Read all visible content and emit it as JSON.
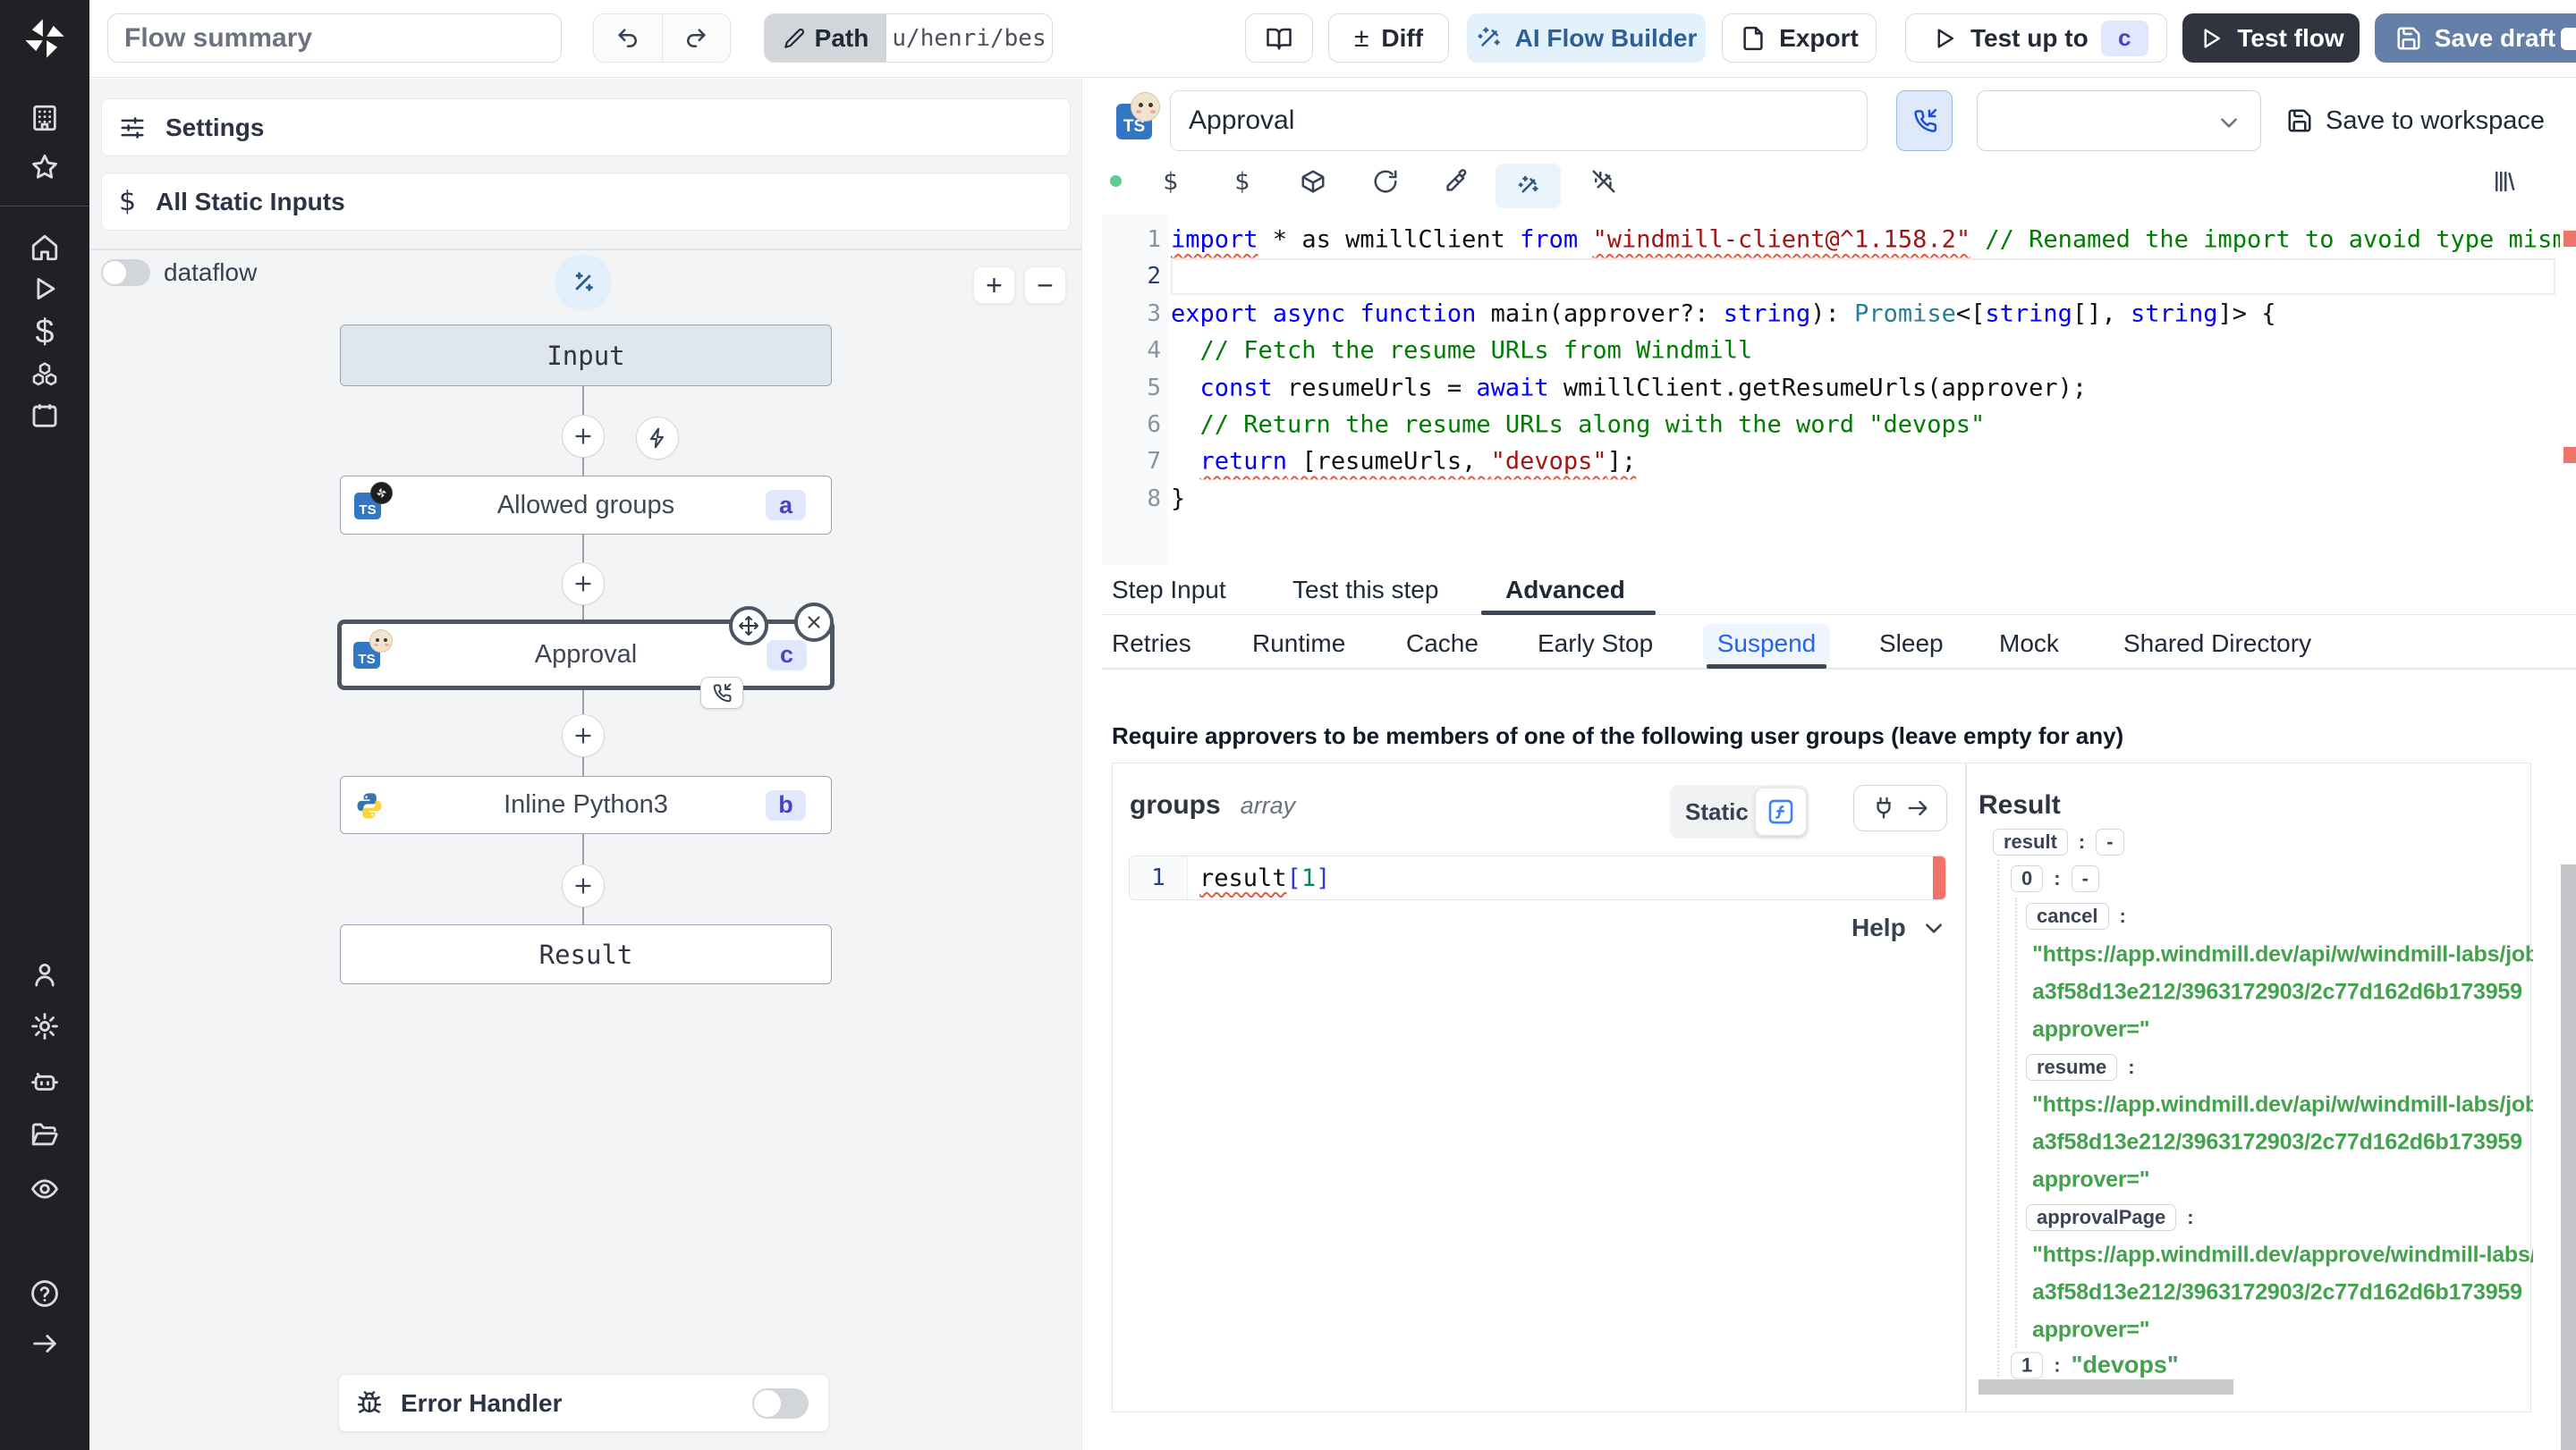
{
  "topbar": {
    "flow_summary_placeholder": "Flow summary",
    "path_label": "Path",
    "path_value": "u/henri/bes",
    "diff_label": "Diff",
    "plusminus": "±",
    "ai_flow_builder_label": "AI Flow Builder",
    "export_label": "Export",
    "test_up_to_label": "Test up to",
    "test_up_to_badge": "c",
    "test_flow_label": "Test flow",
    "save_draft_label": "Save draft"
  },
  "sidebar": {
    "icons": [
      "windmill-logo",
      "buildings",
      "favorites-star",
      "home",
      "runs-play",
      "variables-dollar",
      "resources-boxes",
      "schedules-calendar",
      "user",
      "settings-gear",
      "workers-bot",
      "folders",
      "audit-eye",
      "help",
      "collapse-arrow"
    ]
  },
  "flow_panel": {
    "settings_label": "Settings",
    "all_static_inputs_label": "All Static Inputs",
    "dataflow_label": "dataflow",
    "zoom_in": "+",
    "zoom_out": "−",
    "nodes": {
      "input_label": "Input",
      "allowed_groups": {
        "label": "Allowed groups",
        "badge": "a",
        "lang": "TS"
      },
      "approval": {
        "label": "Approval",
        "badge": "c",
        "lang": "TS"
      },
      "inline_python": {
        "label": "Inline Python3",
        "badge": "b"
      },
      "result_label": "Result"
    },
    "error_handler_label": "Error Handler"
  },
  "editor": {
    "step_name_value": "Approval",
    "save_to_workspace_label": "Save to workspace",
    "lang_badge": "TS",
    "dollar1": "$",
    "dollar2": "$",
    "code": {
      "line_numbers": [
        "1",
        "2",
        "3",
        "4",
        "5",
        "6",
        "7",
        "8"
      ],
      "current_line": "2",
      "lines": [
        [
          {
            "t": "import",
            "c": "kw sq"
          },
          {
            "t": " * as wmillClient ",
            "c": "def"
          },
          {
            "t": "from",
            "c": "kw"
          },
          {
            "t": " ",
            "c": "def"
          },
          {
            "t": "\"windmill-client@^1.158.2\"",
            "c": "str sq"
          },
          {
            "t": " ",
            "c": "def"
          },
          {
            "t": "// Renamed the import to avoid type mismatches",
            "c": "com"
          }
        ],
        [],
        [
          {
            "t": "export",
            "c": "kw"
          },
          {
            "t": " ",
            "c": "def"
          },
          {
            "t": "async",
            "c": "kw"
          },
          {
            "t": " ",
            "c": "def"
          },
          {
            "t": "function",
            "c": "kw"
          },
          {
            "t": " main(approver?: ",
            "c": "def"
          },
          {
            "t": "string",
            "c": "kw"
          },
          {
            "t": "): ",
            "c": "def"
          },
          {
            "t": "Promise",
            "c": "typ"
          },
          {
            "t": "<[",
            "c": "def"
          },
          {
            "t": "string",
            "c": "kw"
          },
          {
            "t": "[], ",
            "c": "def"
          },
          {
            "t": "string",
            "c": "kw"
          },
          {
            "t": "]> {",
            "c": "def"
          }
        ],
        [
          {
            "t": "  ",
            "c": "def"
          },
          {
            "t": "// Fetch the resume URLs from Windmill",
            "c": "com"
          }
        ],
        [
          {
            "t": "  ",
            "c": "def"
          },
          {
            "t": "const",
            "c": "kw"
          },
          {
            "t": " resumeUrls = ",
            "c": "def"
          },
          {
            "t": "await",
            "c": "kw"
          },
          {
            "t": " wmillClient.getResumeUrls(approver);",
            "c": "def"
          }
        ],
        [
          {
            "t": "  ",
            "c": "def"
          },
          {
            "t": "// Return the resume URLs along with the word \"devops\"",
            "c": "com"
          }
        ],
        [
          {
            "t": "  ",
            "c": "def"
          },
          {
            "t": "return",
            "c": "kw sq"
          },
          {
            "t": " [resumeUrls, ",
            "c": "def sq"
          },
          {
            "t": "\"devops\"",
            "c": "str sq"
          },
          {
            "t": "];",
            "c": "def sq"
          }
        ],
        [
          {
            "t": "}",
            "c": "def"
          }
        ]
      ]
    },
    "tabs": [
      "Step Input",
      "Test this step",
      "Advanced"
    ],
    "subtabs": [
      "Retries",
      "Runtime",
      "Cache",
      "Early Stop",
      "Suspend",
      "Sleep",
      "Mock",
      "Shared Directory"
    ],
    "require_text": "Require approvers to be members of one of the following user groups (leave empty for any)",
    "groups": {
      "name": "groups",
      "type": "array",
      "static_label": "Static",
      "editor_line_number": "1",
      "tokens": [
        {
          "t": "result",
          "c": "def sq"
        },
        {
          "t": "[",
          "c": "br"
        },
        {
          "t": "1",
          "c": "num"
        },
        {
          "t": "]",
          "c": "br"
        }
      ],
      "help_label": "Help"
    },
    "result": {
      "title": "Result",
      "colon": ":",
      "dash": "-",
      "key_result": "result",
      "key_0": "0",
      "key_cancel": "cancel",
      "key_resume": "resume",
      "key_approval_page": "approvalPage",
      "key_1": "1",
      "cancel_lines": [
        "\"https://app.windmill.dev/api/w/windmill-labs/jobs",
        "a3f58d13e212/3963172903/2c77d162d6b173959",
        "approver=\""
      ],
      "resume_lines": [
        "\"https://app.windmill.dev/api/w/windmill-labs/jobs",
        "a3f58d13e212/3963172903/2c77d162d6b173959",
        "approver=\""
      ],
      "approval_page_lines": [
        "\"https://app.windmill.dev/approve/windmill-labs/C",
        "a3f58d13e212/3963172903/2c77d162d6b173959",
        "approver=\""
      ],
      "value_1": "\"devops\""
    }
  }
}
